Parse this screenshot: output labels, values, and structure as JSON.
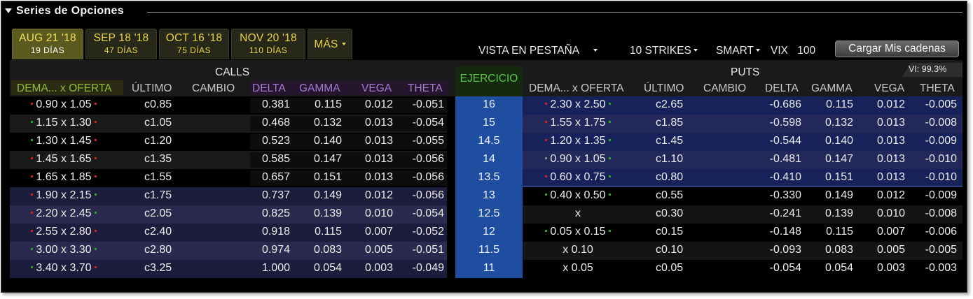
{
  "window": {
    "title": "Series de Opciones"
  },
  "expiry_tabs": [
    {
      "label": "AUG 21 '18",
      "days": "19 DÍAS",
      "active": true
    },
    {
      "label": "SEP 18 '18",
      "days": "47 DÍAS",
      "active": false
    },
    {
      "label": "OCT 16 '18",
      "days": "75 DÍAS",
      "active": false
    },
    {
      "label": "NOV 20 '18",
      "days": "110 DÍAS",
      "active": false
    },
    {
      "label": "MÁS",
      "days": "",
      "active": false
    }
  ],
  "toolbar": {
    "view_mode": "VISTA EN PESTAÑA",
    "strikes": "10 STRIKES",
    "exchange": "SMART",
    "vix_label": "VIX",
    "vix_value": "100",
    "load_button": "Cargar Mis cadenas"
  },
  "calls": {
    "title": "CALLS",
    "columns": [
      "DEMA... x  OFERTA",
      "ÚLTIMO",
      "CAMBIO",
      "DELTA",
      "GAMMA",
      "VEGA",
      "THETA"
    ]
  },
  "strike_header": "EJERCICIO",
  "puts": {
    "title": "PUTS",
    "implied_vol": "VI: 99.3%",
    "columns": [
      "DEMA... x  OFERTA",
      "ÚLTIMO",
      "CAMBIO",
      "DELTA",
      "GAMMA",
      "VEGA",
      "THETA"
    ]
  },
  "colors": {
    "background": "#000000",
    "strike_column": "#1f4ea0",
    "tab_text": "#e8d44a",
    "calls_header_bidask": "#8fbd3a",
    "greek_header": "#a57ad0",
    "strike_header": "#58c44a",
    "tick_up": "#28a428",
    "tick_down": "#d42020"
  },
  "rows": [
    {
      "strike": "16",
      "call": {
        "bid": "0.90",
        "ask": "1.05",
        "bid_tick": "red",
        "ask_tick": "red",
        "last": "c0.85",
        "change": "",
        "delta": "0.381",
        "gamma": "0.115",
        "vega": "0.012",
        "theta": "-0.051"
      },
      "put": {
        "bid": "2.30",
        "ask": "2.50",
        "bid_tick": "red",
        "ask_tick": "green",
        "last": "c2.65",
        "change": "",
        "delta": "-0.686",
        "gamma": "0.115",
        "vega": "0.012",
        "theta": "-0.005"
      }
    },
    {
      "strike": "15",
      "call": {
        "bid": "1.15",
        "ask": "1.30",
        "bid_tick": "green",
        "ask_tick": "red",
        "last": "c1.05",
        "change": "",
        "delta": "0.468",
        "gamma": "0.132",
        "vega": "0.013",
        "theta": "-0.054"
      },
      "put": {
        "bid": "1.55",
        "ask": "1.75",
        "bid_tick": "red",
        "ask_tick": "green",
        "last": "c1.85",
        "change": "",
        "delta": "-0.598",
        "gamma": "0.132",
        "vega": "0.013",
        "theta": "-0.008"
      }
    },
    {
      "strike": "14.5",
      "call": {
        "bid": "1.30",
        "ask": "1.45",
        "bid_tick": "green",
        "ask_tick": "red",
        "last": "c1.20",
        "change": "",
        "delta": "0.523",
        "gamma": "0.140",
        "vega": "0.013",
        "theta": "-0.055"
      },
      "put": {
        "bid": "1.20",
        "ask": "1.35",
        "bid_tick": "red",
        "ask_tick": "green",
        "last": "c1.45",
        "change": "",
        "delta": "-0.544",
        "gamma": "0.140",
        "vega": "0.013",
        "theta": "-0.009"
      }
    },
    {
      "strike": "14",
      "call": {
        "bid": "1.45",
        "ask": "1.65",
        "bid_tick": "red",
        "ask_tick": "red",
        "last": "c1.35",
        "change": "",
        "delta": "0.585",
        "gamma": "0.147",
        "vega": "0.013",
        "theta": "-0.056"
      },
      "put": {
        "bid": "0.90",
        "ask": "1.05",
        "bid_tick": "gray",
        "ask_tick": "green",
        "last": "c1.10",
        "change": "",
        "delta": "-0.481",
        "gamma": "0.147",
        "vega": "0.013",
        "theta": "-0.010"
      }
    },
    {
      "strike": "13.5",
      "call": {
        "bid": "1.65",
        "ask": "1.85",
        "bid_tick": "red",
        "ask_tick": "red",
        "last": "c1.55",
        "change": "",
        "delta": "0.657",
        "gamma": "0.151",
        "vega": "0.013",
        "theta": "-0.056"
      },
      "put": {
        "bid": "0.60",
        "ask": "0.75",
        "bid_tick": "red",
        "ask_tick": "green",
        "last": "c0.80",
        "change": "",
        "delta": "-0.410",
        "gamma": "0.151",
        "vega": "0.013",
        "theta": "-0.010"
      }
    },
    {
      "strike": "13",
      "call": {
        "bid": "1.90",
        "ask": "2.15",
        "bid_tick": "red",
        "ask_tick": "green",
        "last": "c1.75",
        "change": "",
        "delta": "0.737",
        "gamma": "0.149",
        "vega": "0.012",
        "theta": "-0.056"
      },
      "put": {
        "bid": "0.40",
        "ask": "0.50",
        "bid_tick": "green",
        "ask_tick": "green",
        "last": "c0.55",
        "change": "",
        "delta": "-0.330",
        "gamma": "0.149",
        "vega": "0.012",
        "theta": "-0.009"
      }
    },
    {
      "strike": "12.5",
      "call": {
        "bid": "2.20",
        "ask": "2.45",
        "bid_tick": "red",
        "ask_tick": "green",
        "last": "c2.05",
        "change": "",
        "delta": "0.825",
        "gamma": "0.139",
        "vega": "0.010",
        "theta": "-0.054"
      },
      "put": {
        "bid": "",
        "ask": "",
        "bid_tick": "",
        "ask_tick": "",
        "last": "c0.30",
        "change": "",
        "delta": "-0.241",
        "gamma": "0.139",
        "vega": "0.010",
        "theta": "-0.008"
      }
    },
    {
      "strike": "12",
      "call": {
        "bid": "2.55",
        "ask": "2.80",
        "bid_tick": "red",
        "ask_tick": "red",
        "last": "c2.40",
        "change": "",
        "delta": "0.918",
        "gamma": "0.115",
        "vega": "0.007",
        "theta": "-0.052"
      },
      "put": {
        "bid": "0.05",
        "ask": "0.15",
        "bid_tick": "green",
        "ask_tick": "green",
        "last": "c0.15",
        "change": "",
        "delta": "-0.148",
        "gamma": "0.115",
        "vega": "0.007",
        "theta": "-0.006"
      }
    },
    {
      "strike": "11.5",
      "call": {
        "bid": "3.00",
        "ask": "3.30",
        "bid_tick": "green",
        "ask_tick": "green",
        "last": "c2.80",
        "change": "",
        "delta": "0.974",
        "gamma": "0.083",
        "vega": "0.005",
        "theta": "-0.051"
      },
      "put": {
        "bid": "",
        "ask": "0.10",
        "bid_tick": "",
        "ask_tick": "",
        "last": "c0.10",
        "change": "",
        "delta": "-0.093",
        "gamma": "0.083",
        "vega": "0.005",
        "theta": "-0.005"
      }
    },
    {
      "strike": "11",
      "call": {
        "bid": "3.40",
        "ask": "3.70",
        "bid_tick": "green",
        "ask_tick": "red",
        "last": "c3.25",
        "change": "",
        "delta": "1.000",
        "gamma": "0.054",
        "vega": "0.003",
        "theta": "-0.049"
      },
      "put": {
        "bid": "",
        "ask": "0.05",
        "bid_tick": "",
        "ask_tick": "",
        "last": "c0.05",
        "change": "",
        "delta": "-0.054",
        "gamma": "0.054",
        "vega": "0.003",
        "theta": "-0.003"
      }
    }
  ]
}
